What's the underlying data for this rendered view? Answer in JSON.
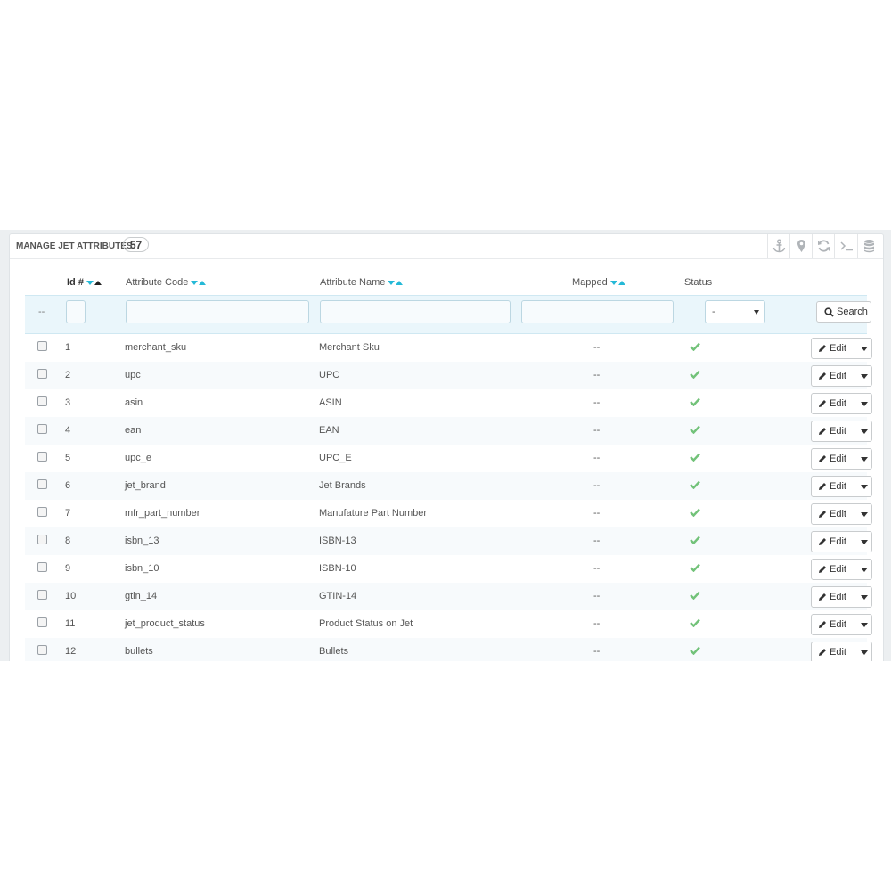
{
  "panel": {
    "title": "MANAGE JET ATTRIBUTES",
    "count": "57",
    "toolbar_icons": [
      "anchor-icon",
      "map-marker-icon",
      "refresh-icon",
      "terminal-icon",
      "database-icon"
    ]
  },
  "columns": {
    "id": "Id #",
    "code": "Attribute Code",
    "name": "Attribute Name",
    "mapped": "Mapped",
    "status": "Status"
  },
  "filters": {
    "bulk_placeholder": "--",
    "status_value": "-",
    "search_label": "Search"
  },
  "rows": [
    {
      "id": "1",
      "code": "merchant_sku",
      "name": "Merchant Sku",
      "mapped": "--",
      "edit": "Edit"
    },
    {
      "id": "2",
      "code": "upc",
      "name": "UPC",
      "mapped": "--",
      "edit": "Edit"
    },
    {
      "id": "3",
      "code": "asin",
      "name": "ASIN",
      "mapped": "--",
      "edit": "Edit"
    },
    {
      "id": "4",
      "code": "ean",
      "name": "EAN",
      "mapped": "--",
      "edit": "Edit"
    },
    {
      "id": "5",
      "code": "upc_e",
      "name": "UPC_E",
      "mapped": "--",
      "edit": "Edit"
    },
    {
      "id": "6",
      "code": "jet_brand",
      "name": "Jet Brands",
      "mapped": "--",
      "edit": "Edit"
    },
    {
      "id": "7",
      "code": "mfr_part_number",
      "name": "Manufature Part Number",
      "mapped": "--",
      "edit": "Edit"
    },
    {
      "id": "8",
      "code": "isbn_13",
      "name": "ISBN-13",
      "mapped": "--",
      "edit": "Edit"
    },
    {
      "id": "9",
      "code": "isbn_10",
      "name": "ISBN-10",
      "mapped": "--",
      "edit": "Edit"
    },
    {
      "id": "10",
      "code": "gtin_14",
      "name": "GTIN-14",
      "mapped": "--",
      "edit": "Edit"
    },
    {
      "id": "11",
      "code": "jet_product_status",
      "name": "Product Status on Jet",
      "mapped": "--",
      "edit": "Edit"
    },
    {
      "id": "12",
      "code": "bullets",
      "name": "Bullets",
      "mapped": "--",
      "edit": "Edit"
    }
  ],
  "colors": {
    "accent": "#25b9d7",
    "check": "#72c279",
    "filter_bg": "#eaf6fb"
  }
}
